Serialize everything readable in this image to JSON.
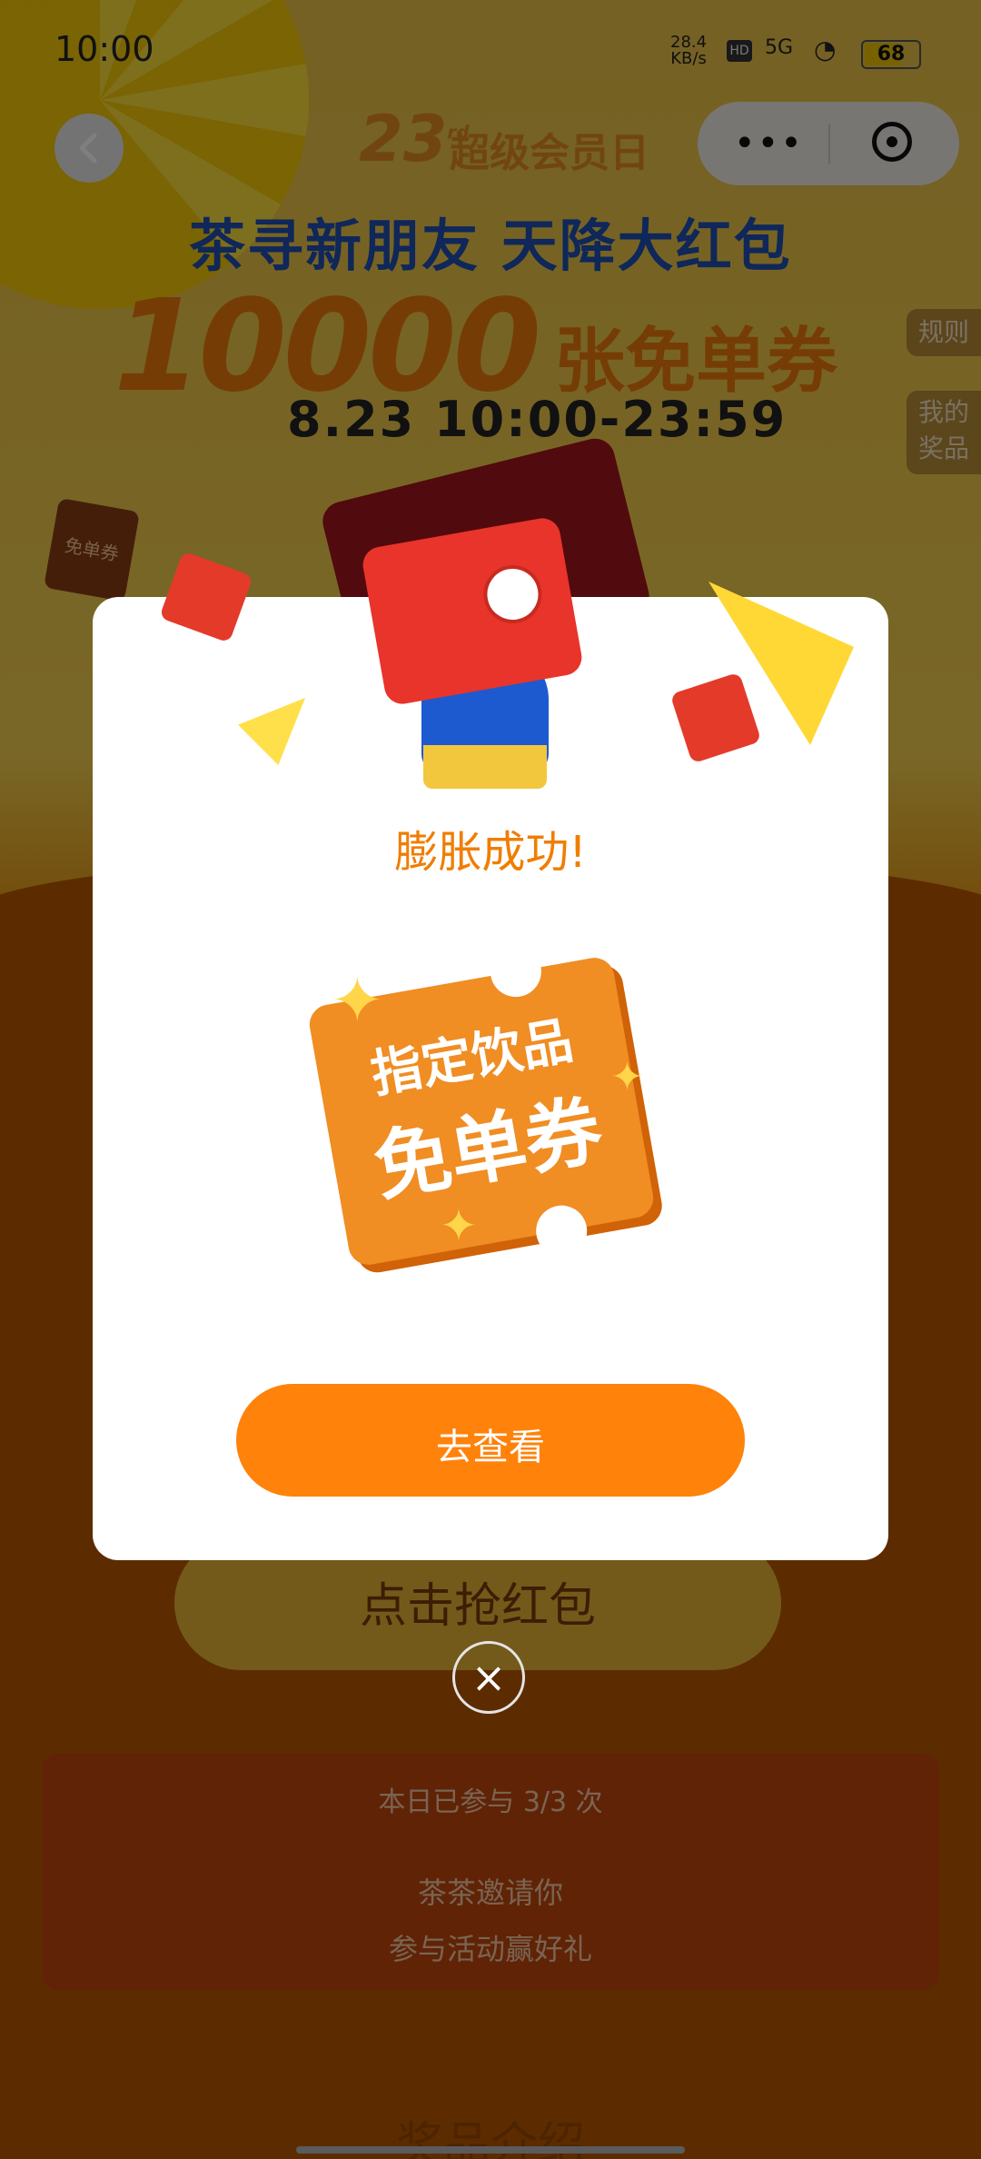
{
  "status_bar": {
    "time": "10:00",
    "net_speed_value": "28.4",
    "net_speed_unit": "KB/s",
    "hd": "HD",
    "signal": "5G",
    "battery": "68"
  },
  "header": {
    "event_number": "23",
    "event_sup": "rd",
    "event_label": "超级会员日",
    "slogan": "茶寻新朋友 天降大红包",
    "big_count": "10000",
    "big_unit": "张免单券",
    "date_time": "8.23 10:00-23:59"
  },
  "side_tabs": {
    "rules": "规则",
    "my_prizes_line1": "我的",
    "my_prizes_line2": "奖品"
  },
  "background": {
    "small_redpack_label": "免单券",
    "grab_button": "点击抢红包",
    "participation": "本日已参与 3/3 次",
    "invite_line1": "茶茶邀请你",
    "invite_line2": "参与活动赢好礼",
    "prize_intro": "奖品介绍"
  },
  "modal": {
    "title": "膨胀成功!",
    "coupon_line1": "指定饮品",
    "coupon_line2": "免单券",
    "view_button": "去查看",
    "close_icon": "×"
  },
  "colors": {
    "accent_orange": "#ff820a",
    "title_orange": "#f07d00",
    "slogan_blue": "#1f4fb3"
  }
}
